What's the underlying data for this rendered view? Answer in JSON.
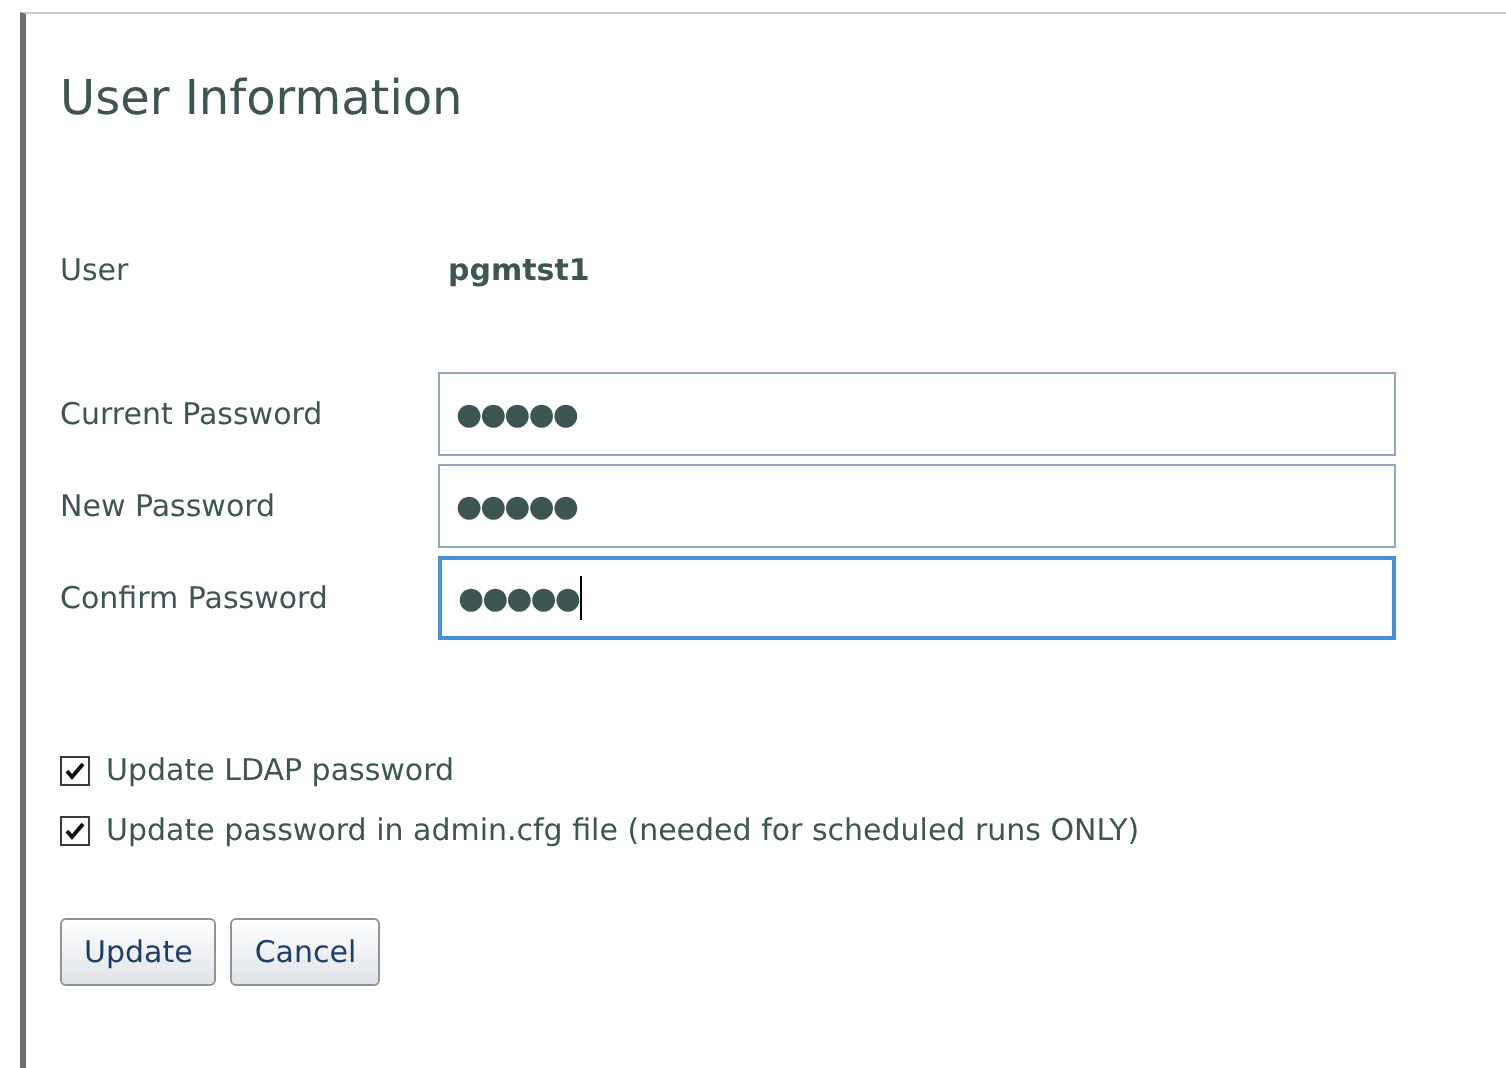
{
  "title": "User Information",
  "user": {
    "label": "User",
    "value": "pgmtst1"
  },
  "fields": [
    {
      "label": "Current Password",
      "value": "●●●●●",
      "focused": false
    },
    {
      "label": "New Password",
      "value": "●●●●●",
      "focused": false
    },
    {
      "label": "Confirm Password",
      "value": "●●●●●",
      "focused": true
    }
  ],
  "options": [
    {
      "label": "Update LDAP password",
      "checked": true
    },
    {
      "label": "Update password in admin.cfg file (needed for scheduled runs ONLY)",
      "checked": true
    }
  ],
  "buttons": [
    "Update",
    "Cancel"
  ]
}
